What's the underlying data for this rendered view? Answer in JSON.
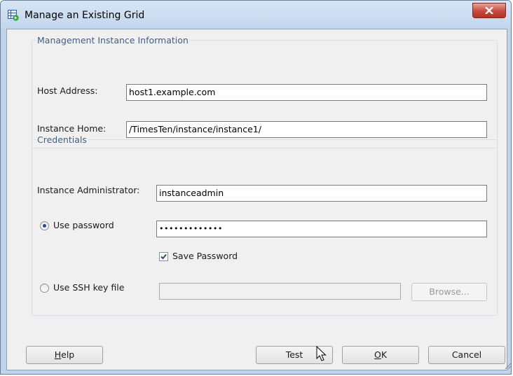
{
  "window": {
    "title": "Manage an Existing Grid"
  },
  "management": {
    "legend": "Management Instance Information",
    "host_label": "Host Address:",
    "host_value": "host1.example.com",
    "home_label": "Instance Home:",
    "home_value": "/TimesTen/instance/instance1/"
  },
  "credentials": {
    "legend": "Credentials",
    "admin_label": "Instance Administrator:",
    "admin_value": "instanceadmin",
    "use_password_label": "Use password",
    "use_password_selected": true,
    "password_value": "•••••••••••••",
    "save_password_label": "Save Password",
    "save_password_checked": true,
    "use_ssh_label": "Use SSH key file",
    "use_ssh_selected": false,
    "ssh_key_value": "",
    "browse_label": "Browse..."
  },
  "buttons": {
    "help_mnemonic": "H",
    "help_rest": "elp",
    "test": "Test",
    "ok_mnemonic": "O",
    "ok_rest": "K",
    "cancel": "Cancel"
  },
  "colors": {
    "accent": "#1f4d8f",
    "legend": "#3e5f8a",
    "close": "#c9493a"
  }
}
